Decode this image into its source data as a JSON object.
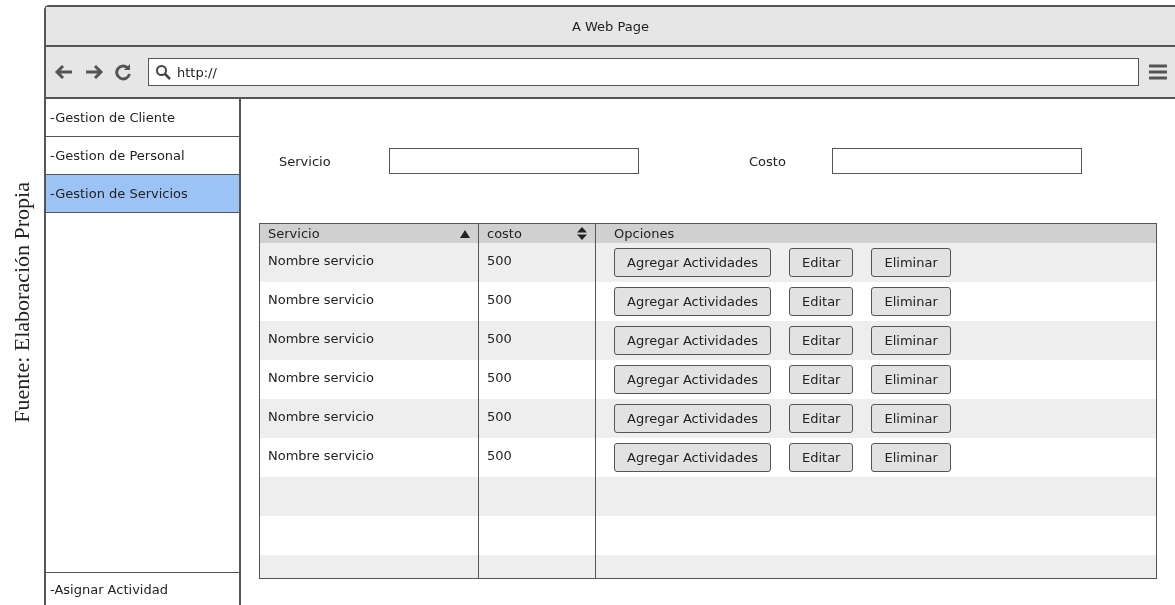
{
  "caption": "Fuente: Elaboración Propia",
  "window": {
    "title": "A Web Page"
  },
  "toolbar": {
    "url": "http://"
  },
  "sidebar": {
    "items": [
      {
        "label": "-Gestion de Cliente",
        "selected": false
      },
      {
        "label": "-Gestion de Personal",
        "selected": false
      },
      {
        "label": "-Gestion de Servicios",
        "selected": true
      }
    ],
    "footer_item": "-Asignar Actividad"
  },
  "form": {
    "fields": [
      {
        "label": "Servicio"
      },
      {
        "label": "Costo"
      }
    ]
  },
  "table": {
    "columns": [
      {
        "label": "Servicio",
        "sortable": true,
        "sorted": true
      },
      {
        "label": "costo",
        "sortable": true,
        "sorted": false
      },
      {
        "label": "Opciones",
        "sortable": false
      }
    ],
    "rows": [
      {
        "servicio": "Nombre servicio",
        "costo": "500",
        "actions": [
          "Agregar Actividades",
          "Editar",
          "Eliminar"
        ]
      },
      {
        "servicio": "Nombre servicio",
        "costo": "500",
        "actions": [
          "Agregar Actividades",
          "Editar",
          "Eliminar"
        ]
      },
      {
        "servicio": "Nombre servicio",
        "costo": "500",
        "actions": [
          "Agregar Actividades",
          "Editar",
          "Eliminar"
        ]
      },
      {
        "servicio": "Nombre servicio",
        "costo": "500",
        "actions": [
          "Agregar Actividades",
          "Editar",
          "Eliminar"
        ]
      },
      {
        "servicio": "Nombre servicio",
        "costo": "500",
        "actions": [
          "Agregar Actividades",
          "Editar",
          "Eliminar"
        ]
      },
      {
        "servicio": "Nombre servicio",
        "costo": "500",
        "actions": [
          "Agregar Actividades",
          "Editar",
          "Eliminar"
        ]
      }
    ]
  }
}
